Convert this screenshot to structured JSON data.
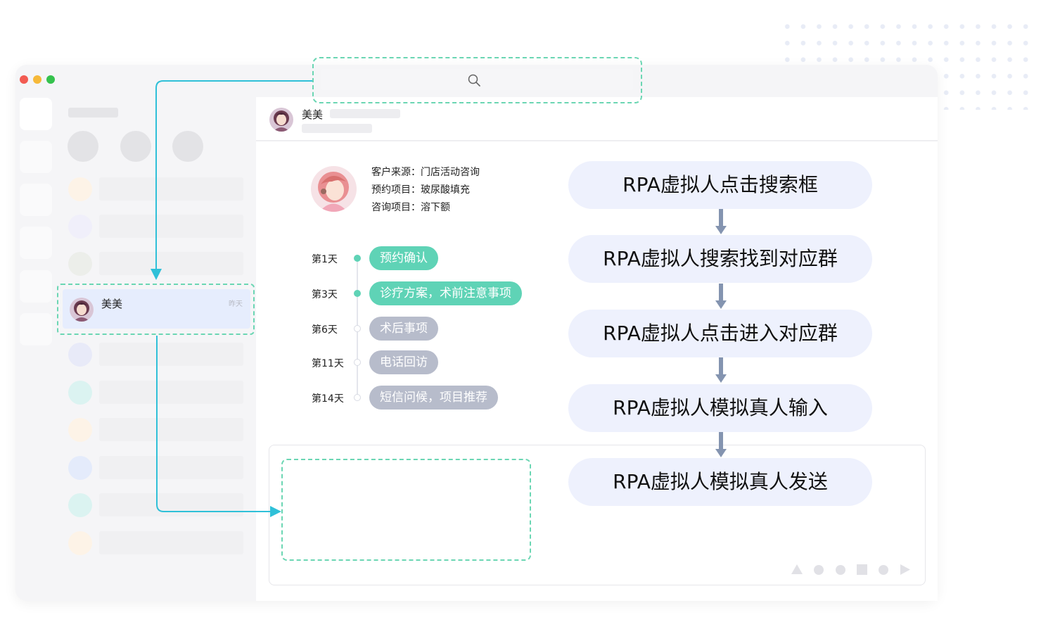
{
  "contact": {
    "name": "美美",
    "time": "昨天"
  },
  "header": {
    "name": "美美"
  },
  "customer_info": [
    "客户来源：门店活动咨询",
    "预约项目：玻尿酸填充",
    "咨询项目：溶下额"
  ],
  "timeline": [
    {
      "day": "第1天",
      "task": "预约确认",
      "status": "done"
    },
    {
      "day": "第3天",
      "task": "诊疗方案，术前注意事项",
      "status": "done"
    },
    {
      "day": "第6天",
      "task": "术后事项",
      "status": "pending"
    },
    {
      "day": "第11天",
      "task": "电话回访",
      "status": "pending"
    },
    {
      "day": "第14天",
      "task": "短信问候，项目推荐",
      "status": "pending"
    }
  ],
  "rpa_steps": [
    "RPA虚拟人点击搜索框",
    "RPA虚拟人搜索找到对应群",
    "RPA虚拟人点击进入对应群",
    "RPA虚拟人模拟真人输入",
    "RPA虚拟人模拟真人发送"
  ],
  "colors": {
    "accent_green": "#5fd3b6",
    "dashed_highlight": "#6bd6b3",
    "connector": "#2fc0d8",
    "step_bg": "#eef1fd",
    "step_arrow": "#8494b0",
    "pending_pill": "#b7bccb",
    "selected_bg": "#e6edfd"
  },
  "icons": {
    "search": "search-icon",
    "toolbar": [
      "triangle-icon",
      "circle-icon",
      "circle-icon",
      "square-icon",
      "circle-icon",
      "play-icon"
    ]
  }
}
